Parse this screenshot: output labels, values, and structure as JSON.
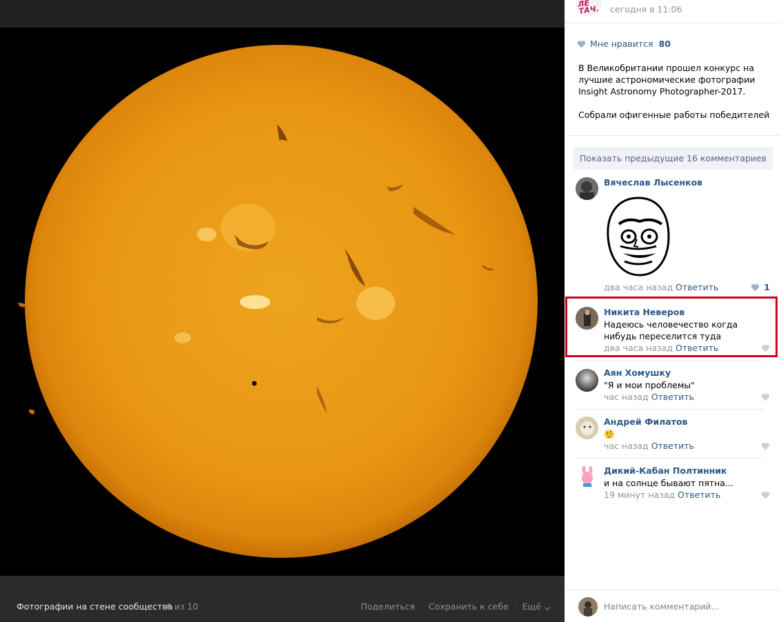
{
  "viewer": {
    "album_title": "Фотографии на стене сообщества",
    "counter": "6 из 10",
    "actions": [
      "Поделиться",
      "Сохранить к себе",
      "Ещё"
    ],
    "separator": "·"
  },
  "post": {
    "group_logo_text": "ЛЕПРА ТАЧ",
    "time": "сегодня в 11:06",
    "like_label": "Мне нравится",
    "like_count": "80",
    "text_lines": [
      "В Великобритании прошел конкурс на",
      "лучшие астрономические фотографии",
      "Insight Astronomy Photographer-2017."
    ],
    "text_footer": "Собрали офигенные работы победителей"
  },
  "comments_block": {
    "show_previous": "Показать предыдущие 16 комментариев",
    "comments": [
      {
        "author": "Вячеслав Лысенков",
        "text": "",
        "time": "два часа назад",
        "reply": "Ответить",
        "likes": "1"
      },
      {
        "author": "Никита Неверов",
        "text": "Надеюсь человечество когда нибудь переселится туда",
        "time": "два часа назад",
        "reply": "Ответить",
        "likes": ""
      },
      {
        "author": "Аян Хомушку",
        "text": "\"Я и мои проблемы\"",
        "time": "час назад",
        "reply": "Ответить",
        "likes": ""
      },
      {
        "author": "Андрей Филатов",
        "text": "🤨",
        "time": "час назад",
        "reply": "Ответить",
        "likes": ""
      },
      {
        "author": "Дикий-Кабан Полтинник",
        "text": "и на солнце бывают пятна...",
        "time": "19 минут назад",
        "reply": "Ответить",
        "likes": ""
      }
    ]
  },
  "reply_box": {
    "placeholder": "Написать комментарий..."
  },
  "colors": {
    "link": "#2a5885",
    "highlight": "#d3001c",
    "sun": "#f09a1a"
  }
}
